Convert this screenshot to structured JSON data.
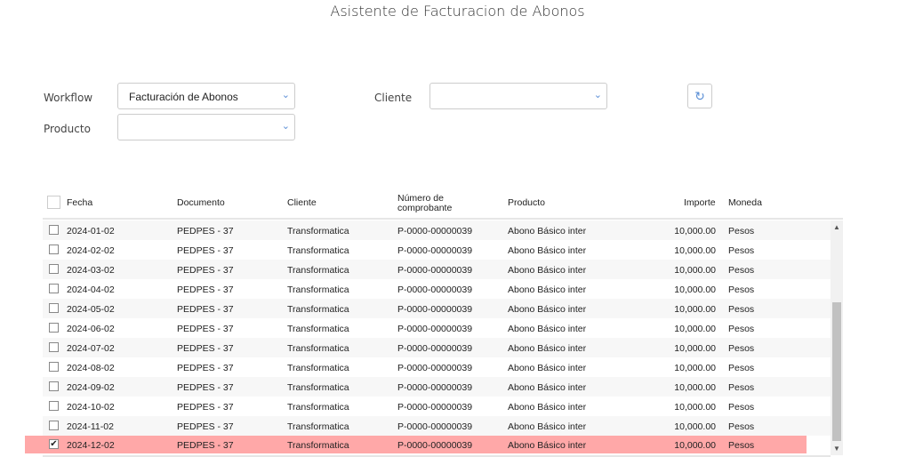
{
  "title": "Asistente de Facturacion de Abonos",
  "filters": {
    "workflow_label": "Workflow",
    "workflow_value": "Facturación de Abonos",
    "cliente_label": "Cliente",
    "cliente_value": "",
    "producto_label": "Producto",
    "producto_value": ""
  },
  "table": {
    "headers": [
      "Fecha",
      "Documento",
      "Cliente",
      "Número de comprobante",
      "Producto",
      "Importe",
      "Moneda"
    ],
    "rows": [
      {
        "fecha": "2024-01-02",
        "documento": "PEDPES - 37",
        "cliente": "Transformatica",
        "numero": "P-0000-00000039",
        "producto": "Abono Básico inter",
        "importe": "10,000.00",
        "moneda": "Pesos",
        "checked": false
      },
      {
        "fecha": "2024-02-02",
        "documento": "PEDPES - 37",
        "cliente": "Transformatica",
        "numero": "P-0000-00000039",
        "producto": "Abono Básico inter",
        "importe": "10,000.00",
        "moneda": "Pesos",
        "checked": false
      },
      {
        "fecha": "2024-03-02",
        "documento": "PEDPES - 37",
        "cliente": "Transformatica",
        "numero": "P-0000-00000039",
        "producto": "Abono Básico inter",
        "importe": "10,000.00",
        "moneda": "Pesos",
        "checked": false
      },
      {
        "fecha": "2024-04-02",
        "documento": "PEDPES - 37",
        "cliente": "Transformatica",
        "numero": "P-0000-00000039",
        "producto": "Abono Básico inter",
        "importe": "10,000.00",
        "moneda": "Pesos",
        "checked": false
      },
      {
        "fecha": "2024-05-02",
        "documento": "PEDPES - 37",
        "cliente": "Transformatica",
        "numero": "P-0000-00000039",
        "producto": "Abono Básico inter",
        "importe": "10,000.00",
        "moneda": "Pesos",
        "checked": false
      },
      {
        "fecha": "2024-06-02",
        "documento": "PEDPES - 37",
        "cliente": "Transformatica",
        "numero": "P-0000-00000039",
        "producto": "Abono Básico inter",
        "importe": "10,000.00",
        "moneda": "Pesos",
        "checked": false
      },
      {
        "fecha": "2024-07-02",
        "documento": "PEDPES - 37",
        "cliente": "Transformatica",
        "numero": "P-0000-00000039",
        "producto": "Abono Básico inter",
        "importe": "10,000.00",
        "moneda": "Pesos",
        "checked": false
      },
      {
        "fecha": "2024-08-02",
        "documento": "PEDPES - 37",
        "cliente": "Transformatica",
        "numero": "P-0000-00000039",
        "producto": "Abono Básico inter",
        "importe": "10,000.00",
        "moneda": "Pesos",
        "checked": false
      },
      {
        "fecha": "2024-09-02",
        "documento": "PEDPES - 37",
        "cliente": "Transformatica",
        "numero": "P-0000-00000039",
        "producto": "Abono Básico inter",
        "importe": "10,000.00",
        "moneda": "Pesos",
        "checked": false
      },
      {
        "fecha": "2024-10-02",
        "documento": "PEDPES - 37",
        "cliente": "Transformatica",
        "numero": "P-0000-00000039",
        "producto": "Abono Básico inter",
        "importe": "10,000.00",
        "moneda": "Pesos",
        "checked": false
      },
      {
        "fecha": "2024-11-02",
        "documento": "PEDPES - 37",
        "cliente": "Transformatica",
        "numero": "P-0000-00000039",
        "producto": "Abono Básico inter",
        "importe": "10,000.00",
        "moneda": "Pesos",
        "checked": false
      },
      {
        "fecha": "2024-12-02",
        "documento": "PEDPES - 37",
        "cliente": "Transformatica",
        "numero": "P-0000-00000039",
        "producto": "Abono Básico inter",
        "importe": "10,000.00",
        "moneda": "Pesos",
        "checked": true
      }
    ]
  },
  "colors": {
    "selected_row": "#ffa8a8",
    "accent": "#5b8fd6"
  }
}
